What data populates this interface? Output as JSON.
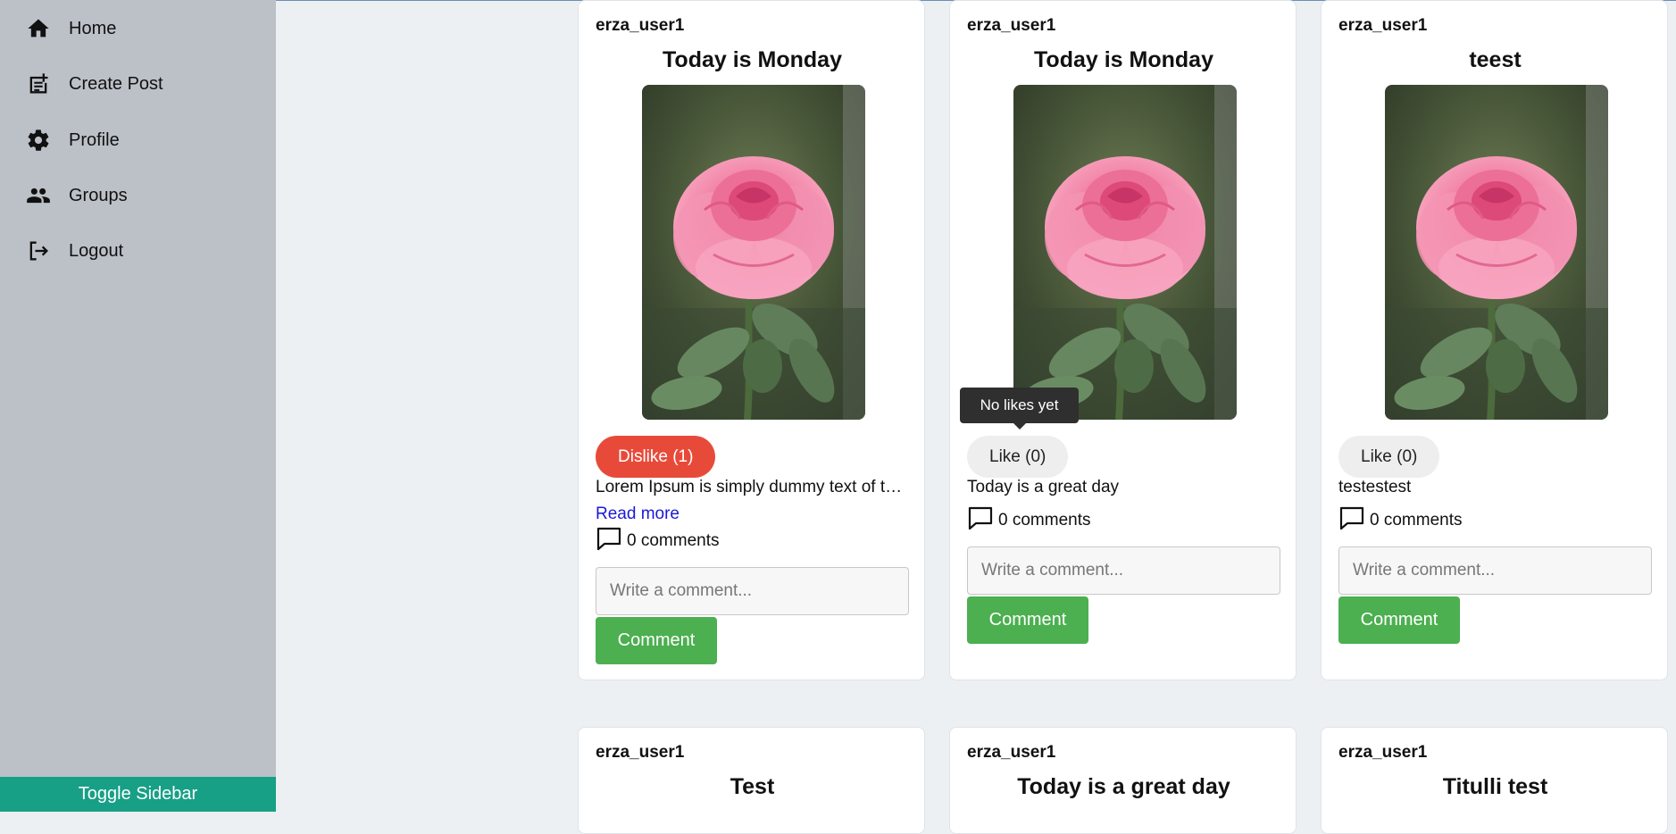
{
  "sidebar": {
    "items": [
      {
        "label": "Home",
        "icon": "home-icon"
      },
      {
        "label": "Create Post",
        "icon": "create-post-icon"
      },
      {
        "label": "Profile",
        "icon": "gear-icon"
      },
      {
        "label": "Groups",
        "icon": "groups-icon"
      },
      {
        "label": "Logout",
        "icon": "logout-icon"
      }
    ],
    "toggle_label": "Toggle Sidebar"
  },
  "posts": [
    {
      "author": "erza_user1",
      "title": "Today is Monday",
      "like_label": "Dislike (1)",
      "description": "Lorem Ipsum is simply dummy text of the printing and typesetting industry.",
      "read_more": "Read more",
      "comments_label": "0 comments",
      "comment_placeholder": "Write a comment...",
      "comment_button": "Comment"
    },
    {
      "author": "erza_user1",
      "title": "Today is Monday",
      "like_label": "Like (0)",
      "description": "Today is a great day",
      "comments_label": "0 comments",
      "comment_placeholder": "Write a comment...",
      "comment_button": "Comment",
      "tooltip": "No likes yet"
    },
    {
      "author": "erza_user1",
      "title": "teest",
      "like_label": "Like (0)",
      "description": "testestest",
      "comments_label": "0 comments",
      "comment_placeholder": "Write a comment...",
      "comment_button": "Comment"
    },
    {
      "author": "erza_user1",
      "title": "Test"
    },
    {
      "author": "erza_user1",
      "title": "Today is a great day"
    },
    {
      "author": "erza_user1",
      "title": "Titulli test"
    }
  ],
  "colors": {
    "sidebar_bg": "#bcc1c8",
    "toggle_bg": "#17a086",
    "dislike": "#e84a3a",
    "comment_button": "#4caf50",
    "link": "#1a1ad6"
  }
}
